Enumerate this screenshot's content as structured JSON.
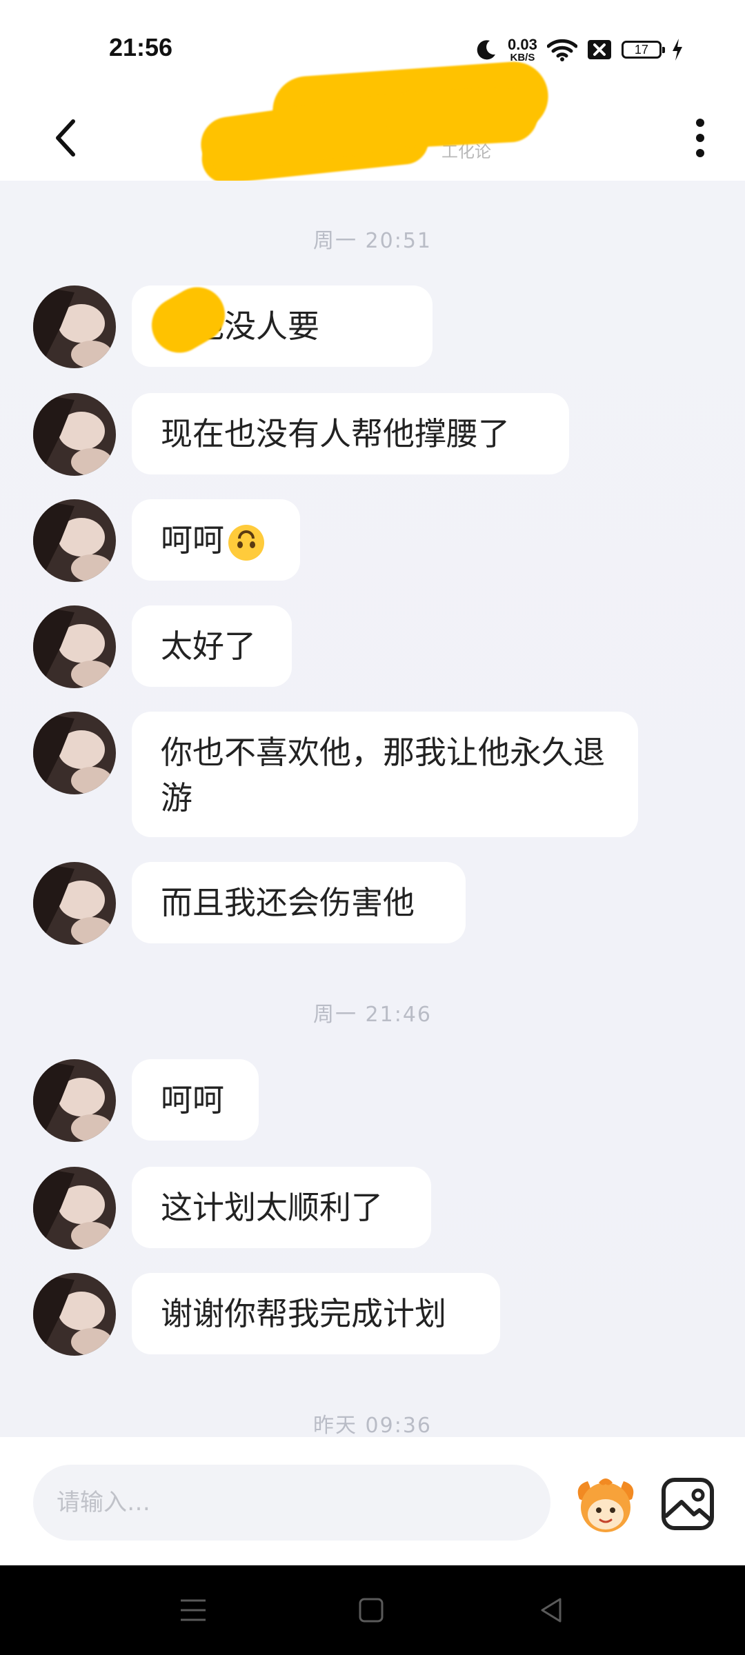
{
  "status_bar": {
    "time": "21:56",
    "net_speed_value": "0.03",
    "net_speed_unit": "KB/S",
    "battery": "17",
    "icons": [
      "moon-icon",
      "wifi-icon",
      "sim-off-icon",
      "battery-icon",
      "charging-icon"
    ]
  },
  "header": {
    "title_redacted": true,
    "subtitle": "工化论",
    "icons": [
      "back-arrow-icon",
      "more-vertical-icon"
    ]
  },
  "chat": {
    "timestamps": [
      "周一 20:51",
      "周一 21:46",
      "昨天 09:36"
    ],
    "messages": [
      {
        "text": "人他没人要"
      },
      {
        "text": "现在也没有人帮他撑腰了"
      },
      {
        "text": "呵呵",
        "emoji": "upside-down-face"
      },
      {
        "text": "太好了"
      },
      {
        "text": "你也不喜欢他，那我让他永久退游"
      },
      {
        "text": "而且我还会伤害他"
      },
      {
        "text": "呵呵"
      },
      {
        "text": "这计划太顺利了"
      },
      {
        "text": "谢谢你帮我完成计划"
      }
    ]
  },
  "input": {
    "placeholder": "请输入…"
  },
  "colors": {
    "background": "#f1f2f7",
    "bubble": "#ffffff",
    "redaction": "#ffc200",
    "timestamp": "#b9bcc6"
  }
}
